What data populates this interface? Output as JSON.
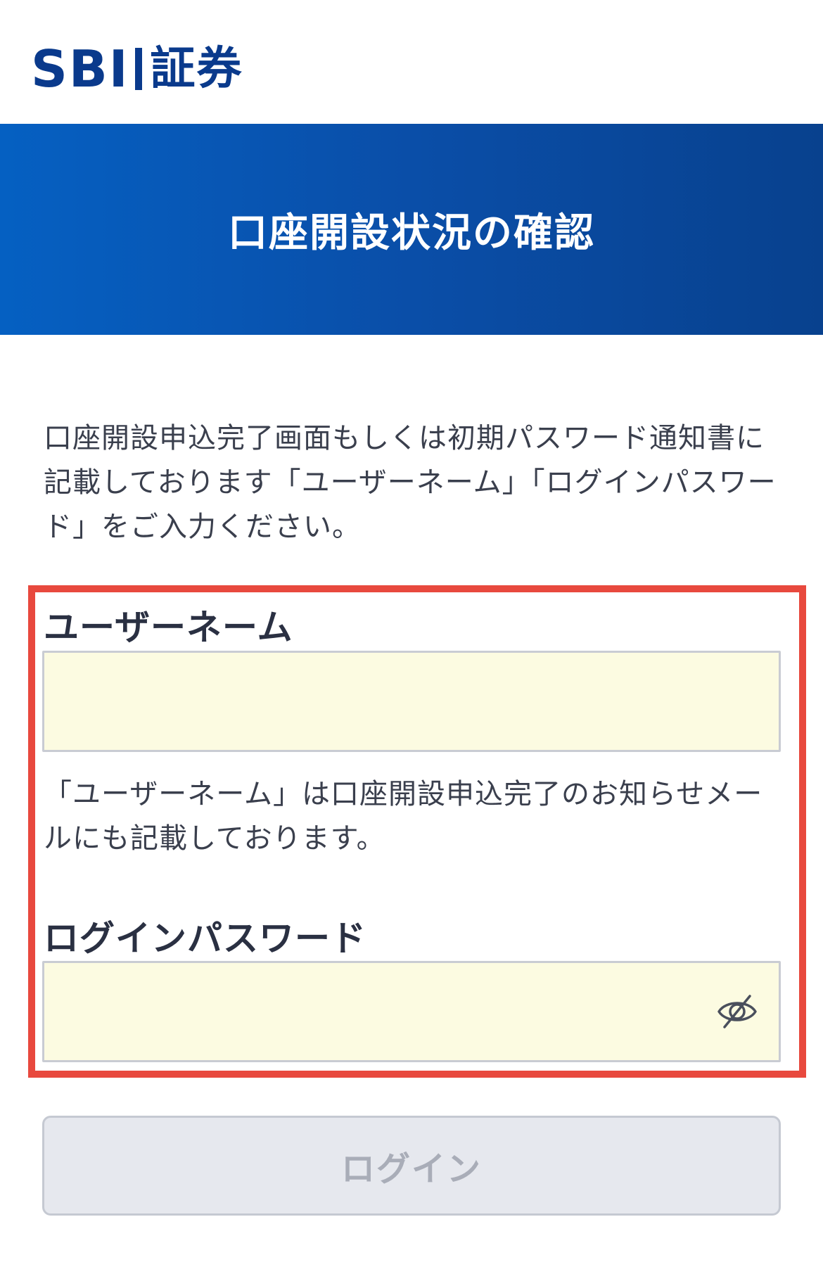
{
  "header": {
    "logo_text": "SBI",
    "logo_text_jp": "証券"
  },
  "banner": {
    "title": "口座開設状況の確認"
  },
  "intro": {
    "text": "口座開設申込完了画面もしくは初期パスワード通知書に記載しております「ユーザーネーム」「ログインパスワード」をご入力ください。"
  },
  "form": {
    "username": {
      "label": "ユーザーネーム",
      "value": "",
      "placeholder": ""
    },
    "username_helper": "「ユーザーネーム」は口座開設申込完了のお知らせメールにも記載しております。",
    "password": {
      "label": "ログインパスワード",
      "value": "",
      "placeholder": "",
      "toggle_icon": "eye-off-icon"
    },
    "login_label": "ログイン"
  },
  "colors": {
    "brand": "#0a3a8c",
    "banner_gradient_start": "#0560c2",
    "banner_gradient_end": "#08418e",
    "input_background": "#fcfbe1",
    "highlight_border": "#e8493e",
    "button_disabled_bg": "#e6e8ee",
    "button_disabled_text": "#a9adb8"
  }
}
